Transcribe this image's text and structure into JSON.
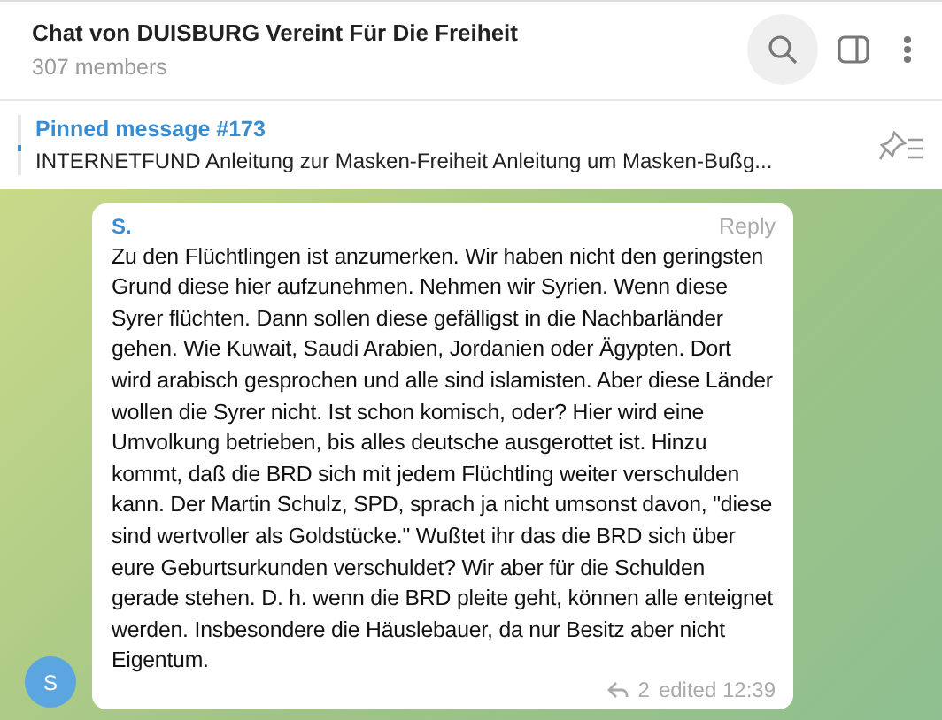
{
  "header": {
    "title": "Chat von DUISBURG Vereint Für Die Freiheit",
    "subtitle": "307 members"
  },
  "pinned": {
    "label": "Pinned message #173",
    "text": "INTERNETFUND  Anleitung zur Masken-Freiheit  Anleitung um Masken-Bußg..."
  },
  "message": {
    "author": "S.",
    "avatar_letter": "S",
    "reply_label": "Reply",
    "text": "Zu den Flüchtlingen ist anzumerken. Wir haben nicht den geringsten Grund diese hier aufzunehmen. Nehmen wir Syrien. Wenn diese Syrer flüchten. Dann sollen diese gefälligst in die Nachbarländer gehen. Wie Kuwait, Saudi Arabien, Jordanien oder Ägypten. Dort wird arabisch gesprochen und alle sind islamisten. Aber diese Länder wollen die Syrer nicht. Ist schon komisch, oder? Hier wird eine Umvolkung betrieben, bis alles deutsche ausgerottet ist. Hinzu kommt, daß die BRD sich mit jedem Flüchtling weiter verschulden kann.  Der Martin Schulz, SPD, sprach ja nicht umsonst davon, \"diese sind wertvoller als Goldstücke.\" Wußtet ihr das die BRD sich über eure Geburtsurkunden verschuldet? Wir aber für die Schulden gerade stehen. D. h. wenn die BRD pleite geht, können alle enteignet werden. Insbesondere die Häuslebauer, da nur Besitz aber nicht Eigentum.",
    "replies": "2",
    "edited": "edited 12:39"
  }
}
